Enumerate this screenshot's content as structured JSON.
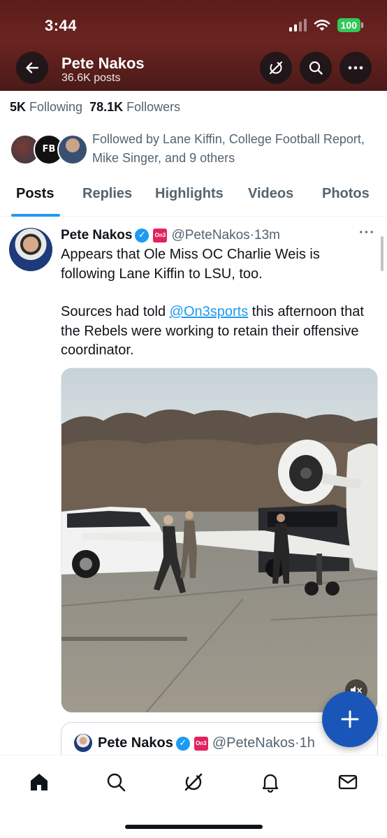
{
  "status_bar": {
    "time": "3:44",
    "battery": "100"
  },
  "header": {
    "name": "Pete Nakos",
    "posts_count": "36.6K posts"
  },
  "profile": {
    "following_count": "5K",
    "following_label": "Following",
    "followers_count": "78.1K",
    "followers_label": "Followers",
    "followed_by": "Followed by Lane Kiffin, College Football Report, Mike Singer, and 9 others",
    "fb_avatar_text": "FB"
  },
  "tabs": [
    {
      "label": "Posts",
      "active": true
    },
    {
      "label": "Replies"
    },
    {
      "label": "Highlights"
    },
    {
      "label": "Videos"
    },
    {
      "label": "Photos"
    }
  ],
  "tweet": {
    "name": "Pete Nakos",
    "affiliate_badge": "On3",
    "handle": "@PeteNakos",
    "time": "·13m",
    "paragraph_1": "Appears that Ole Miss OC Charlie Weis is following Lane Kiffin to LSU, too.",
    "paragraph_2_start": "Sources had told ",
    "mention": "@On3sports",
    "paragraph_2_end": " this afternoon that the Rebels were working to retain their offensive coordinator."
  },
  "quoted_tweet": {
    "name": "Pete Nakos",
    "affiliate_badge": "On3",
    "handle": "@PeteNakos",
    "time": "·1h"
  },
  "colors": {
    "accent": "#1d9bf0",
    "fab": "#1a56b8",
    "header_bg": "#5a1d1b",
    "battery": "#34c759"
  },
  "icons": {
    "header": [
      "back-arrow-icon",
      "grok-icon",
      "search-icon",
      "more-icon"
    ],
    "bottom_nav": [
      "home-icon",
      "search-icon",
      "grok-icon",
      "bell-icon",
      "mail-icon"
    ],
    "fab": "plus-icon"
  }
}
